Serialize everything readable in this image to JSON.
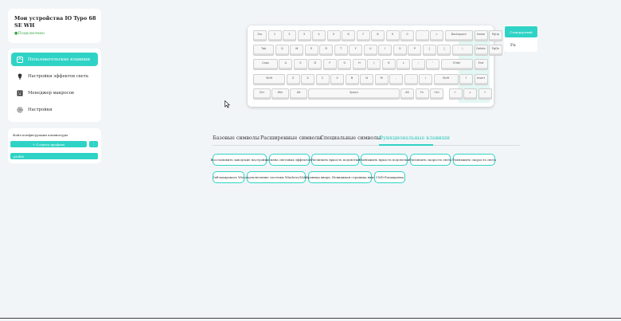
{
  "device": {
    "title": "Мои устройства IO Typo 68 SE WH",
    "status": "Подключено"
  },
  "nav": {
    "items": [
      {
        "label": "Пользовательские клавиши",
        "icon": "keyboard-icon",
        "active": true
      },
      {
        "label": "Настройки эффектов света",
        "icon": "bulb-icon",
        "active": false
      },
      {
        "label": "Менеджер макросов",
        "icon": "macro-icon",
        "active": false
      },
      {
        "label": "Настройки",
        "icon": "gear-icon",
        "active": false
      }
    ]
  },
  "config": {
    "header": "Файл конфигурации клавиатуры",
    "create_label": "+ Создать профиль",
    "menu_label": "⋮",
    "profile": "profile"
  },
  "keyboard": {
    "rows": [
      [
        "Esc",
        "1",
        "2",
        "3",
        "4",
        "5",
        "6",
        "7",
        "8",
        "9",
        "0",
        "-",
        "=",
        "Backspace",
        "Home",
        "PgUp"
      ],
      [
        "Tab",
        "Q",
        "W",
        "E",
        "R",
        "T",
        "Y",
        "U",
        "I",
        "O",
        "P",
        "[",
        "]",
        "\\",
        "Delete",
        "PgDn"
      ],
      [
        "Caps",
        "A",
        "S",
        "D",
        "F",
        "G",
        "H",
        "J",
        "K",
        "L",
        ";",
        "'",
        "Enter",
        "End"
      ],
      [
        "Shift",
        "Z",
        "X",
        "C",
        "V",
        "B",
        "N",
        "M",
        ",",
        ".",
        "/",
        "Shift",
        "↑",
        "Insert"
      ],
      [
        "Ctrl",
        "Win",
        "Alt",
        "Space",
        "Alt",
        "Fn",
        "Ctrl",
        "←",
        "↓",
        "→"
      ]
    ]
  },
  "layers": {
    "standard": "Стандартный",
    "fn": "Fn"
  },
  "tabs": [
    "Базовые символы",
    "Расширенные символы",
    "Специальные символы",
    "Функциональные клавиши"
  ],
  "function_keys": [
    "Восстановить заводские настройки",
    "Смена световых эффектов",
    "Увеличить яркость подсветки",
    "Уменьшить яркость подсветки",
    "Увеличить скорость света",
    "Уменьшить скорость света",
    "Заблокировать Win",
    "переключение системы Windows/MAC",
    "страница вверх, Невидимая страница вниз",
    "CMD-блокировка"
  ],
  "colors": {
    "accent": "#2fd3c5",
    "connected": "#3aa845",
    "background": "#f2f5f8"
  }
}
